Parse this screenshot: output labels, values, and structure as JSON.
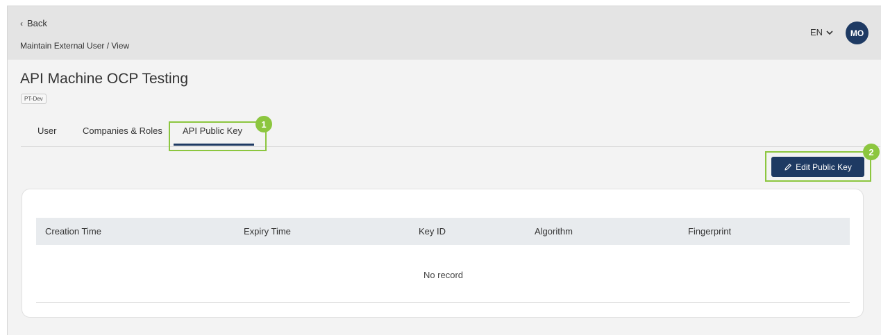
{
  "header": {
    "back_label": "Back",
    "breadcrumb": "Maintain External User / View",
    "language": "EN",
    "avatar_initials": "MO"
  },
  "page": {
    "title": "API Machine OCP Testing",
    "badge": "PT-Dev"
  },
  "tabs": [
    {
      "label": "User",
      "active": false
    },
    {
      "label": "Companies & Roles",
      "active": false
    },
    {
      "label": "API Public Key",
      "active": true
    }
  ],
  "actions": {
    "edit_public_key": "Edit Public Key"
  },
  "callouts": [
    "1",
    "2"
  ],
  "table": {
    "columns": [
      "Creation Time",
      "Expiry Time",
      "Key ID",
      "Algorithm",
      "Fingerprint"
    ],
    "empty_text": "No record"
  },
  "colors": {
    "primary": "#1e3a63",
    "highlight": "#8cc63f"
  }
}
